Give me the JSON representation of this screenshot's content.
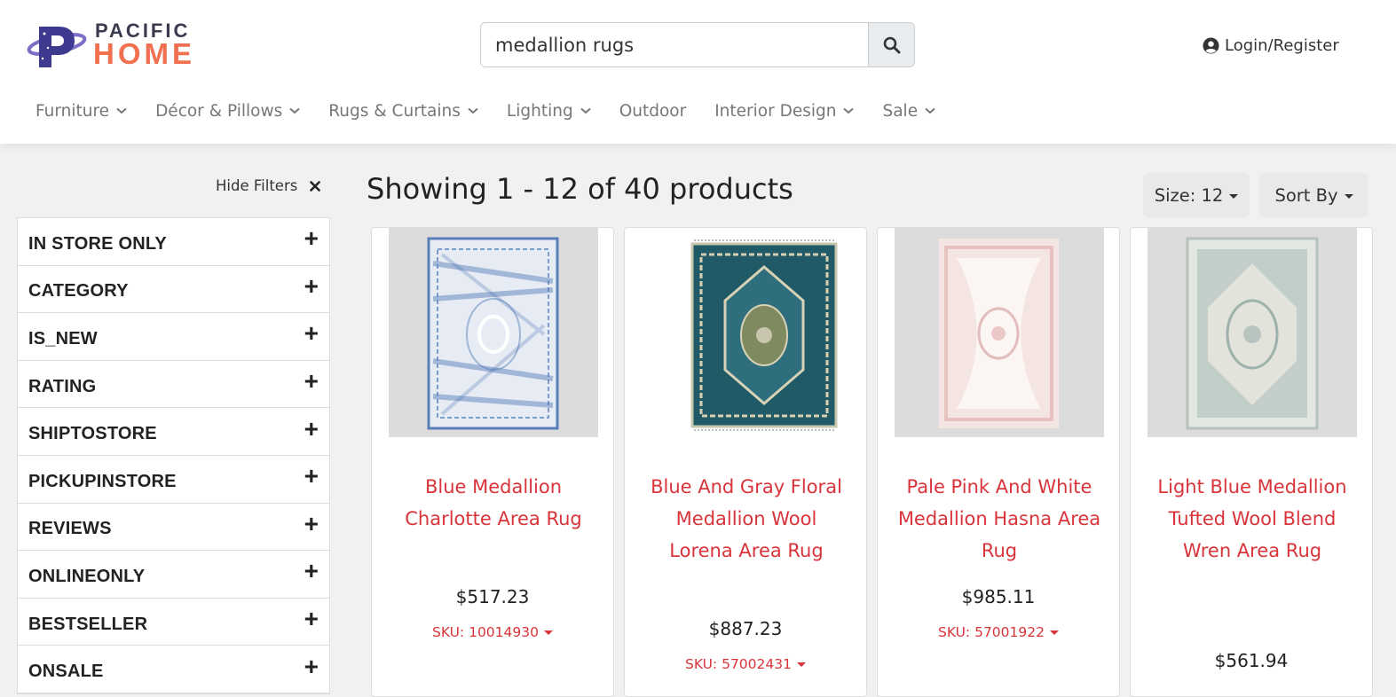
{
  "brand": {
    "line1": "PACIFIC",
    "line2": "HOME",
    "primary_color": "#3b3b50",
    "accent_color": "#f07050",
    "mark_icon": "logo-p-icon"
  },
  "search": {
    "value": "medallion rugs",
    "placeholder": "",
    "button_icon": "search-icon"
  },
  "account": {
    "login_label": "Login/Register",
    "icon": "user-circle-icon"
  },
  "nav": [
    {
      "label": "Furniture",
      "has_dropdown": true
    },
    {
      "label": "Décor & Pillows",
      "has_dropdown": true
    },
    {
      "label": "Rugs & Curtains",
      "has_dropdown": true
    },
    {
      "label": "Lighting",
      "has_dropdown": true
    },
    {
      "label": "Outdoor",
      "has_dropdown": false
    },
    {
      "label": "Interior Design",
      "has_dropdown": true
    },
    {
      "label": "Sale",
      "has_dropdown": true
    }
  ],
  "sidebar": {
    "hide_filters_label": "Hide Filters",
    "hide_icon": "close-icon",
    "filters": [
      {
        "label": "IN STORE ONLY",
        "icon": "+"
      },
      {
        "label": "CATEGORY",
        "icon": "+"
      },
      {
        "label": "IS_NEW",
        "icon": "+"
      },
      {
        "label": "RATING",
        "icon": "+"
      },
      {
        "label": "SHIPTOSTORE",
        "icon": "+"
      },
      {
        "label": "PICKUPINSTORE",
        "icon": "+"
      },
      {
        "label": "REVIEWS",
        "icon": "+"
      },
      {
        "label": "ONLINEONLY",
        "icon": "+"
      },
      {
        "label": "BESTSELLER",
        "icon": "+"
      },
      {
        "label": "ONSALE",
        "icon": "+"
      }
    ]
  },
  "results": {
    "title": "Showing 1 - 12 of 40 products",
    "size_label": "Size: 12",
    "sort_label": "Sort By"
  },
  "products": [
    {
      "name": "Blue Medallion Charlotte Area Rug",
      "price": "$517.23",
      "sku": "SKU: 10014930",
      "image": "rug-blue-distressed"
    },
    {
      "name": "Blue And Gray Floral Medallion Wool Lorena Area Rug",
      "price": "$887.23",
      "sku": "SKU: 57002431",
      "image": "rug-teal-medallion"
    },
    {
      "name": "Pale Pink And White Medallion Hasna Area Rug",
      "price": "$985.11",
      "sku": "SKU: 57001922",
      "image": "rug-pale-pink"
    },
    {
      "name": "Light Blue Medallion Tufted Wool Blend Wren Area Rug",
      "price": "$561.94",
      "sku": "",
      "image": "rug-light-blue"
    }
  ],
  "colors": {
    "link_red": "#d9343a",
    "nav_gray": "#777777",
    "page_bg": "#f1f1f1"
  }
}
